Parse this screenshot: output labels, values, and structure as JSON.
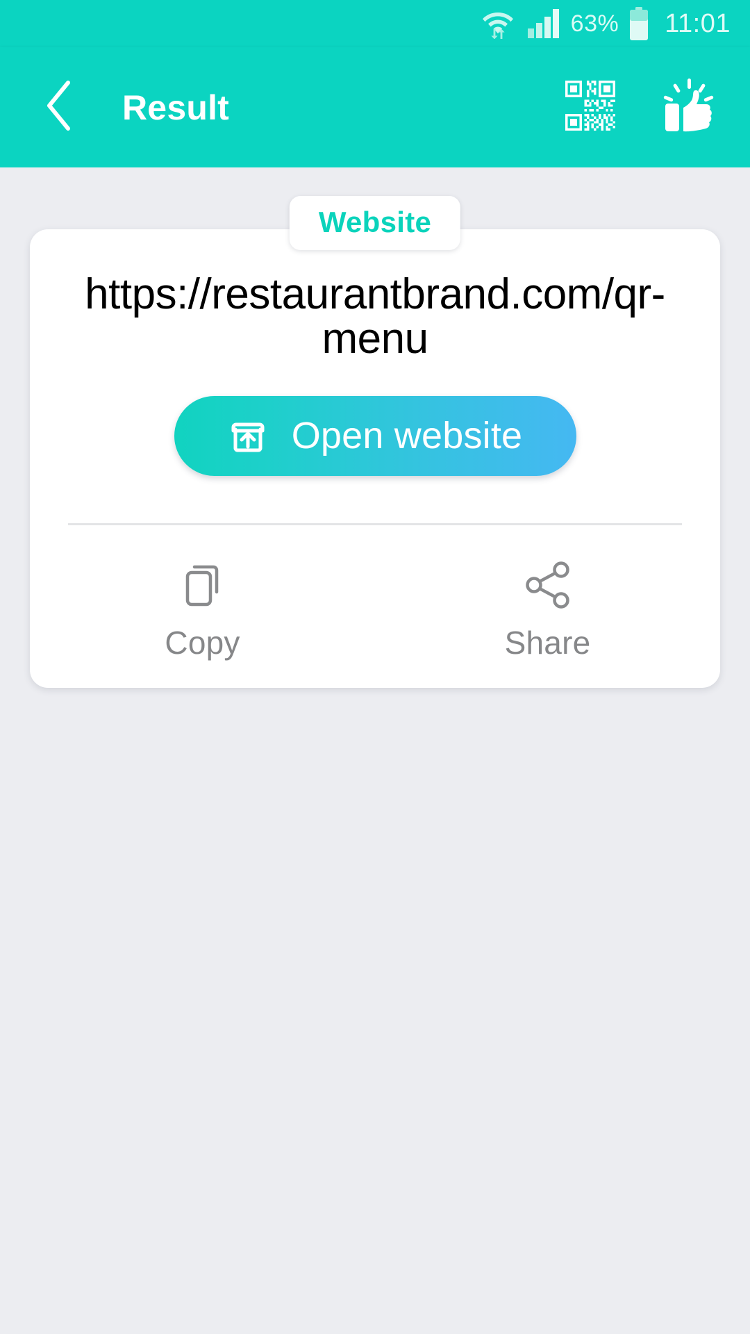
{
  "status_bar": {
    "wifi_icon": "wifi-icon",
    "signal_icon": "cellular-signal-icon",
    "battery_percent": "63%",
    "battery_icon": "battery-icon",
    "clock": "11:01"
  },
  "app_bar": {
    "back_icon": "chevron-left-icon",
    "title": "Result",
    "actions": [
      {
        "icon": "qr-code-icon",
        "name": "qr-code-button"
      },
      {
        "icon": "thumbs-up-icon",
        "name": "rate-app-button"
      }
    ]
  },
  "result": {
    "type_badge": "Website",
    "value": "https://restaurantbrand.com/qr-menu",
    "primary_action": {
      "label": "Open website",
      "icon": "open-in-new-icon"
    },
    "secondary_actions": [
      {
        "label": "Copy",
        "icon": "copy-icon"
      },
      {
        "label": "Share",
        "icon": "share-icon"
      }
    ]
  },
  "colors": {
    "accent_teal": "#0bd4c1",
    "badge_text": "#0ad3bb",
    "button_gradient_start": "#11d3c0",
    "button_gradient_end": "#45b8f2",
    "page_background": "#ecedf1",
    "card_background": "#ffffff",
    "secondary_label": "#868789"
  }
}
